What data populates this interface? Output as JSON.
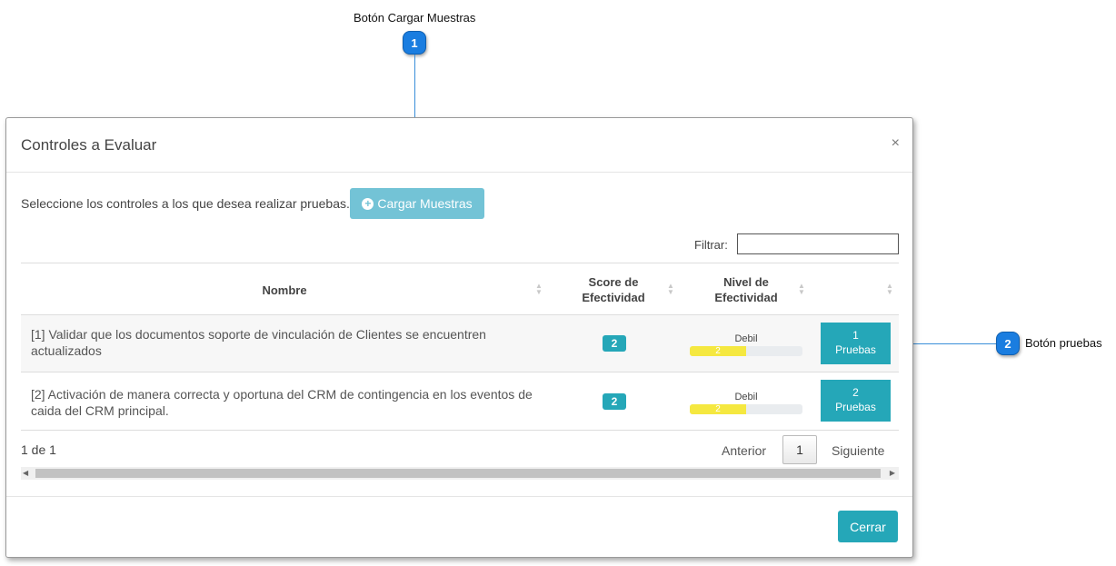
{
  "callouts": [
    {
      "number": "1",
      "label": "Botón Cargar Muestras"
    },
    {
      "number": "2",
      "label": "Botón pruebas"
    }
  ],
  "modal": {
    "title": "Controles a Evaluar",
    "close": "×",
    "intro": "Seleccione los controles a los que desea realizar pruebas.",
    "load_button": "Cargar Muestras",
    "filter_label": "Filtrar:",
    "filter_value": "",
    "columns": [
      "Nombre",
      "Score de Efectividad",
      "Nivel de Efectividad",
      ""
    ],
    "rows": [
      {
        "name": "[1] Validar que los documentos soporte de vinculación de Clientes se encuentren actualizados",
        "score": "2",
        "level_label": "Debil",
        "level_value": "2",
        "level_fraction": 0.5,
        "tests_count": "1",
        "tests_label": "Pruebas"
      },
      {
        "name": "[2] Activación de manera correcta y oportuna del CRM de contingencia en los eventos de caida del CRM principal.",
        "score": "2",
        "level_label": "Debil",
        "level_value": "2",
        "level_fraction": 0.5,
        "tests_count": "2",
        "tests_label": "Pruebas"
      }
    ],
    "paging_info": "1 de 1",
    "prev_label": "Anterior",
    "page_number": "1",
    "next_label": "Siguiente",
    "close_button": "Cerrar"
  },
  "colors": {
    "accent": "#25a7b8",
    "callout": "#1a7de0",
    "bar_fill": "#f5e840"
  }
}
